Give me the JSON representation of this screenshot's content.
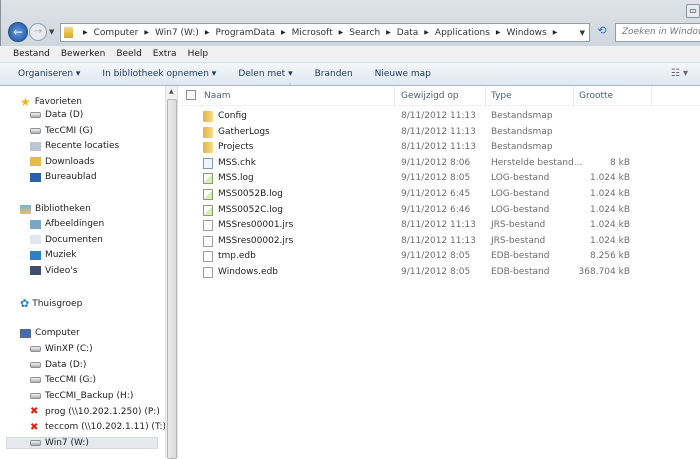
{
  "address": {
    "crumbs": [
      "Computer",
      "Win7 (W:)",
      "ProgramData",
      "Microsoft",
      "Search",
      "Data",
      "Applications",
      "Windows"
    ],
    "search_placeholder": "Zoeken in Windows"
  },
  "menu": [
    "Bestand",
    "Bewerken",
    "Beeld",
    "Extra",
    "Help"
  ],
  "toolbar": [
    "Organiseren ▾",
    "In bibliotheek opnemen ▾",
    "Delen met ▾",
    "Branden",
    "Nieuwe map"
  ],
  "sidebar": {
    "favorites": {
      "label": "Favorieten",
      "items": [
        "Data (D)",
        "TecCMI (G)",
        "Recente locaties",
        "Downloads",
        "Bureaublad"
      ]
    },
    "libraries": {
      "label": "Bibliotheken",
      "items": [
        "Afbeeldingen",
        "Documenten",
        "Muziek",
        "Video's"
      ]
    },
    "homegroup": "Thuisgroep",
    "computer": {
      "label": "Computer",
      "items": [
        "WinXP (C:)",
        "Data (D:)",
        "TecCMI (G:)",
        "TecCMI_Backup (H:)",
        "prog (\\\\10.202.1.250) (P:)",
        "teccom (\\\\10.202.1.11) (T:)",
        "Win7 (W:)"
      ]
    }
  },
  "columns": {
    "name": "Naam",
    "modified": "Gewijzigd op",
    "type": "Type",
    "size": "Grootte"
  },
  "files": [
    {
      "name": "Config",
      "modified": "8/11/2012 11:13",
      "type": "Bestandsmap",
      "size": "",
      "icon": "folder"
    },
    {
      "name": "GatherLogs",
      "modified": "8/11/2012 11:13",
      "type": "Bestandsmap",
      "size": "",
      "icon": "folder"
    },
    {
      "name": "Projects",
      "modified": "8/11/2012 11:13",
      "type": "Bestandsmap",
      "size": "",
      "icon": "folder"
    },
    {
      "name": "MSS.chk",
      "modified": "9/11/2012 8:06",
      "type": "Herstelde bestand...",
      "size": "8 kB",
      "icon": "chkf"
    },
    {
      "name": "MSS.log",
      "modified": "9/11/2012 8:05",
      "type": "LOG-bestand",
      "size": "1.024 kB",
      "icon": "log"
    },
    {
      "name": "MSS0052B.log",
      "modified": "9/11/2012 6:45",
      "type": "LOG-bestand",
      "size": "1.024 kB",
      "icon": "log"
    },
    {
      "name": "MSS0052C.log",
      "modified": "9/11/2012 6:46",
      "type": "LOG-bestand",
      "size": "1.024 kB",
      "icon": "log"
    },
    {
      "name": "MSSres00001.jrs",
      "modified": "8/11/2012 11:13",
      "type": "JRS-bestand",
      "size": "1.024 kB",
      "icon": "file"
    },
    {
      "name": "MSSres00002.jrs",
      "modified": "8/11/2012 11:13",
      "type": "JRS-bestand",
      "size": "1.024 kB",
      "icon": "file"
    },
    {
      "name": "tmp.edb",
      "modified": "9/11/2012 8:05",
      "type": "EDB-bestand",
      "size": "8.256 kB",
      "icon": "file"
    },
    {
      "name": "Windows.edb",
      "modified": "9/11/2012 8:05",
      "type": "EDB-bestand",
      "size": "368.704 kB",
      "icon": "file"
    }
  ]
}
